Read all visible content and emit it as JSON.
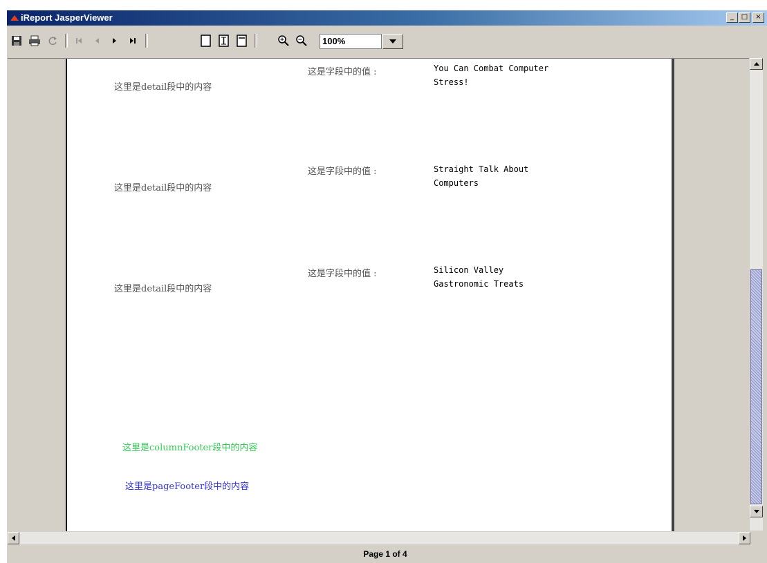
{
  "window": {
    "title": "iReport JasperViewer",
    "controls": {
      "minimize": "_",
      "maximize": "□",
      "close": "×"
    }
  },
  "toolbar": {
    "buttons": [
      "save-icon",
      "print-icon",
      "reload-icon",
      "first-page-icon",
      "previous-page-icon",
      "next-page-icon",
      "last-page-icon",
      "actual-size-icon",
      "fit-page-icon",
      "fit-width-icon",
      "zoom-in-icon",
      "zoom-out-icon"
    ],
    "zoom_value": "100%"
  },
  "report": {
    "detail_rows": [
      {
        "label": "这里是detail段中的内容",
        "field_label": "这是字段中的值 :",
        "value_line1": "You Can Combat Computer",
        "value_line2": "Stress!"
      },
      {
        "label": "这里是detail段中的内容",
        "field_label": "这是字段中的值 :",
        "value_line1": "Straight Talk About",
        "value_line2": "Computers"
      },
      {
        "label": "这里是detail段中的内容",
        "field_label": "这是字段中的值 :",
        "value_line1": "Silicon Valley",
        "value_line2": "Gastronomic Treats"
      }
    ],
    "column_footer": "这里是columnFooter段中的内容",
    "page_footer": "这里是pageFooter段中的内容",
    "colors": {
      "column_footer": "#33cc55",
      "page_footer": "#3333dd"
    }
  },
  "status": {
    "page_text": "Page 1 of 4"
  }
}
